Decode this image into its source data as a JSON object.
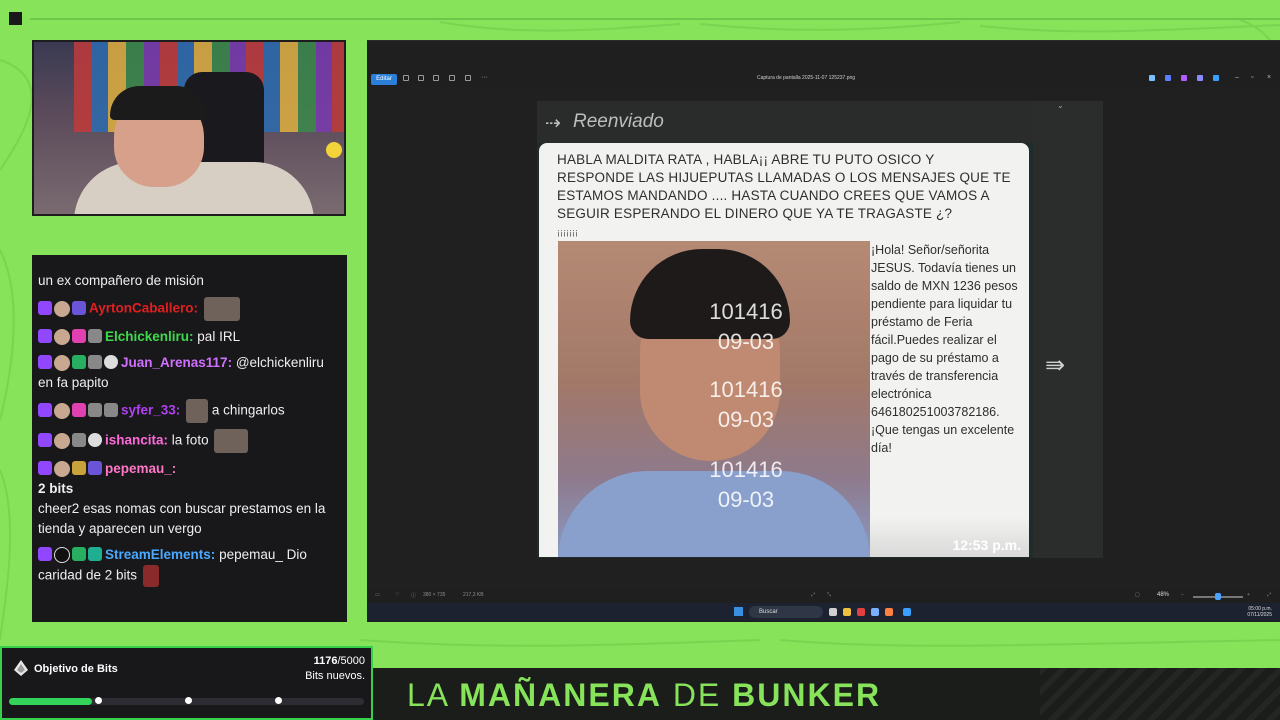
{
  "chat": {
    "lines": [
      {
        "text": "un ex compañero de misión"
      },
      {
        "user": "AyrtonCaballero:",
        "user_color": "#e02020",
        "text": ""
      },
      {
        "user": "Elchickenliru:",
        "user_color": "#3fd94c",
        "text": "pal IRL"
      },
      {
        "user": "Juan_Arenas117:",
        "user_color": "#d070ff",
        "text": "@elchickenliru en fa papito"
      },
      {
        "user": "syfer_33:",
        "user_color": "#b040f0",
        "text": "a chingarlos"
      },
      {
        "user": "ishancita:",
        "user_color": "#ff6adb",
        "text": "la foto"
      },
      {
        "user": "pepemau_:",
        "user_color": "#ff78c8",
        "text": ""
      },
      {
        "bits": "2 bits",
        "text": "cheer2 esas nomas con buscar prestamos en la tienda y aparecen un vergo"
      },
      {
        "user": "StreamElements:",
        "user_color": "#4aa8ff",
        "text": "pepemau_ Dio caridad de 2 bits"
      }
    ]
  },
  "bits_goal": {
    "title": "Objetivo de Bits",
    "current": "1176",
    "target": "/5000",
    "subtitle": "Bits nuevos.",
    "progress_fraction": 0.2352
  },
  "banner": {
    "word1": "LA",
    "word2": "MAÑANERA",
    "word3": "DE",
    "word4": "BUNKER"
  },
  "viewer": {
    "edit_label": "Editar",
    "file_title": "Captura de pantalla 2025-11-07 125237.png",
    "dimensions": "380 × 735",
    "file_size": "217,3 KB",
    "zoom": "48%"
  },
  "whatsapp": {
    "forwarded_label": "Reenviado",
    "message": "HABLA MALDITA RATA , HABLA¡¡ ABRE TU PUTO OSICO Y RESPONDE LAS HIJUEPUTAS LLAMADAS O LOS MENSAJES QUE TE ESTAMOS MANDANDO .... HASTA CUANDO CREES QUE VAMOS A SEGUIR ESPERANDO EL DINERO QUE YA TE TRAGASTE ¿?",
    "marks": "¡¡¡¡¡¡¡",
    "watermark_code": "101416",
    "watermark_date": "09-03",
    "side_text": "¡Hola! Señor/señorita JESUS. Todavía tienes un saldo de MXN 1236 pesos pendiente para liquidar tu préstamo de Feria fácil.Puedes realizar el pago de su préstamo a través de transferencia electrónica 646180251003782186. ¡Que tengas un excelente día!",
    "time": "12:53 p.m."
  },
  "taskbar": {
    "search_label": "Buscar",
    "clock_time": "05:00 p.m.",
    "clock_date": "07/11/2025"
  },
  "colors": {
    "background_green": "#86e35a",
    "chat_bg": "#18181b",
    "goal_border": "#37d04a"
  }
}
